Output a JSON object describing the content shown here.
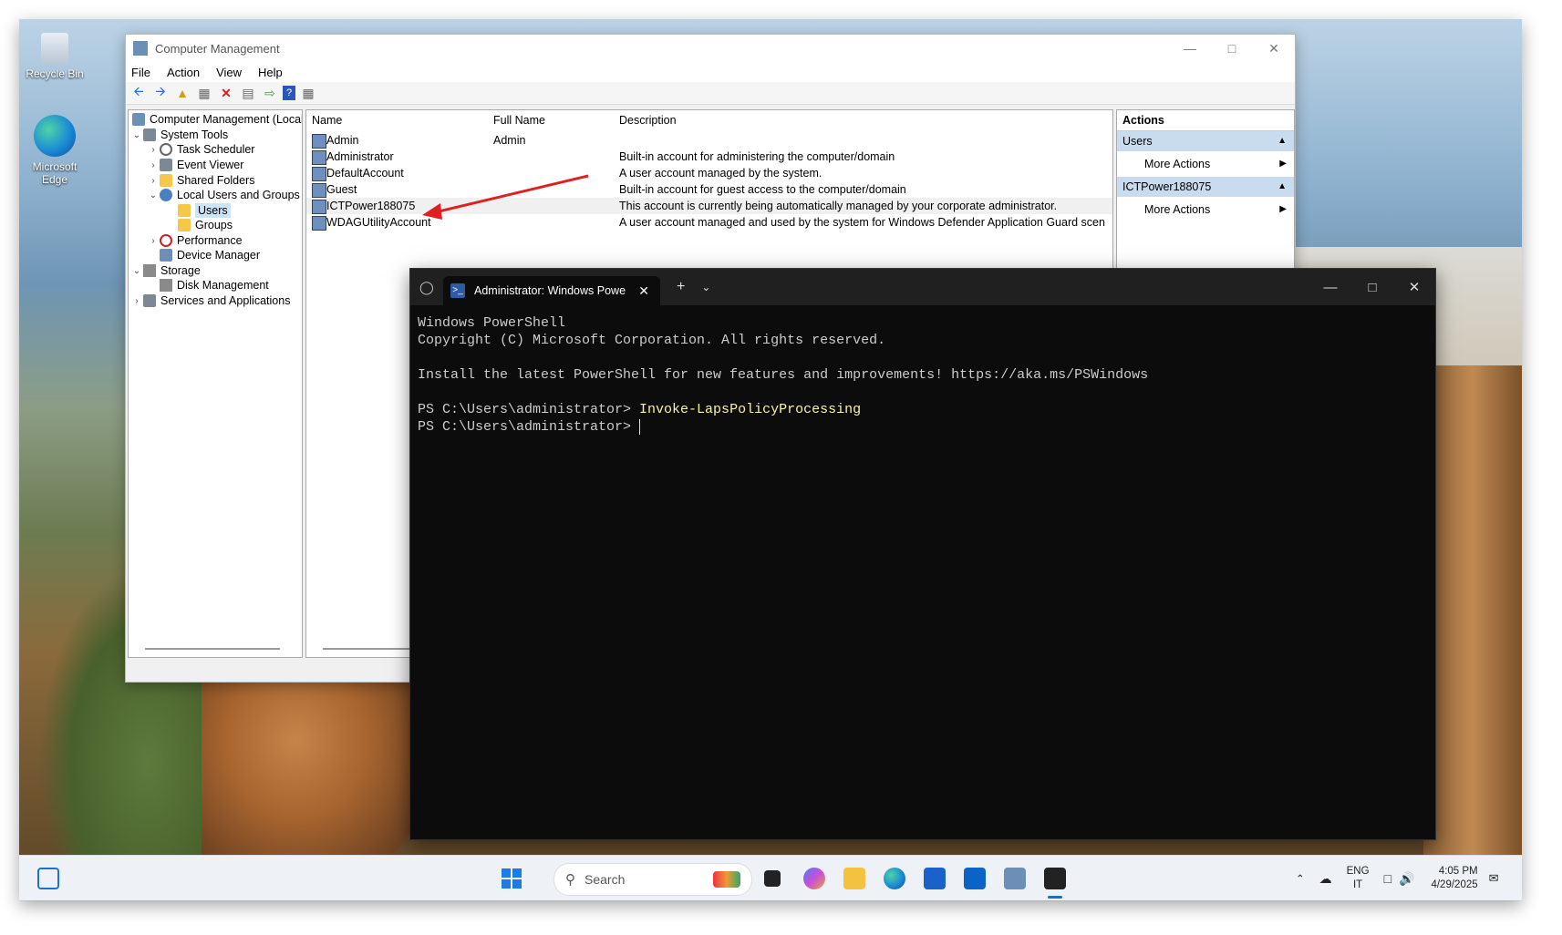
{
  "desktop": {
    "icons": [
      {
        "label": "Recycle Bin"
      },
      {
        "label": "Microsoft Edge"
      }
    ]
  },
  "cm": {
    "title": "Computer Management",
    "menu": [
      "File",
      "Action",
      "View",
      "Help"
    ],
    "tree": {
      "root": "Computer Management (Local",
      "system_tools": "System Tools",
      "task_scheduler": "Task Scheduler",
      "event_viewer": "Event Viewer",
      "shared_folders": "Shared Folders",
      "local_users_groups": "Local Users and Groups",
      "users": "Users",
      "groups": "Groups",
      "performance": "Performance",
      "device_manager": "Device Manager",
      "storage": "Storage",
      "disk_management": "Disk Management",
      "services_apps": "Services and Applications"
    },
    "columns": {
      "name": "Name",
      "full_name": "Full Name",
      "description": "Description"
    },
    "rows": [
      {
        "name": "Admin",
        "full_name": "Admin",
        "description": ""
      },
      {
        "name": "Administrator",
        "full_name": "",
        "description": "Built-in account for administering the computer/domain"
      },
      {
        "name": "DefaultAccount",
        "full_name": "",
        "description": "A user account managed by the system."
      },
      {
        "name": "Guest",
        "full_name": "",
        "description": "Built-in account for guest access to the computer/domain"
      },
      {
        "name": "ICTPower188075",
        "full_name": "",
        "description": "This account is currently being automatically managed by your corporate administrator."
      },
      {
        "name": "WDAGUtilityAccount",
        "full_name": "",
        "description": "A user account managed and used by the system for Windows Defender Application Guard scen"
      }
    ],
    "actions": {
      "header": "Actions",
      "section1": "Users",
      "more1": "More Actions",
      "section2": "ICTPower188075",
      "more2": "More Actions"
    }
  },
  "terminal": {
    "tab_title": "Administrator: Windows Powe",
    "lines": {
      "l1": "Windows PowerShell",
      "l2": "Copyright (C) Microsoft Corporation. All rights reserved.",
      "l3": "Install the latest PowerShell for new features and improvements! https://aka.ms/PSWindows",
      "prompt1": "PS C:\\Users\\administrator> ",
      "cmd1": "Invoke-LapsPolicyProcessing",
      "prompt2": "PS C:\\Users\\administrator> "
    }
  },
  "taskbar": {
    "search_placeholder": "Search",
    "lang": "ENG",
    "region": "IT",
    "time": "4:05 PM",
    "date": "4/29/2025"
  },
  "colors": {
    "arrow": "#e02020",
    "accent": "#0078d4",
    "cmd": "#f9f1a5"
  }
}
